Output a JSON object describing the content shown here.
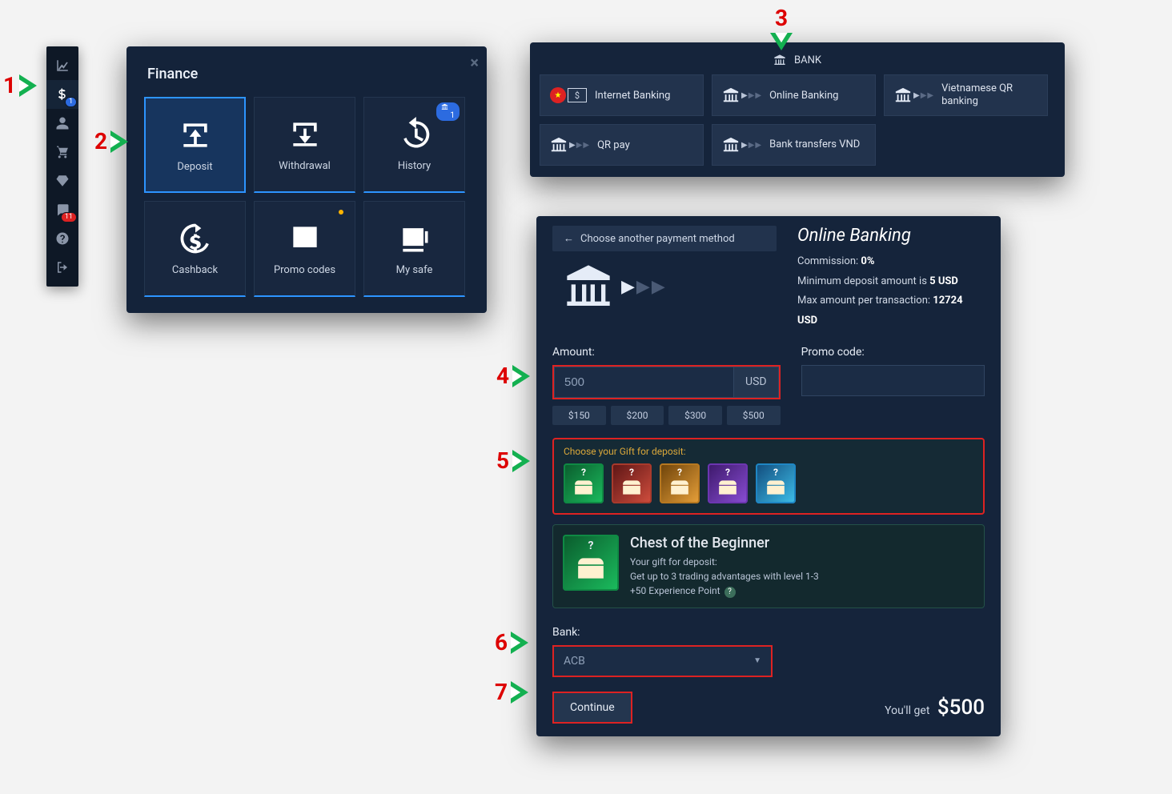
{
  "steps": [
    "1",
    "2",
    "3",
    "4",
    "5",
    "6",
    "7"
  ],
  "sidebar": {
    "items": [
      {
        "name": "chart-icon",
        "badge": null
      },
      {
        "name": "dollar-icon",
        "badge": "1",
        "active": true
      },
      {
        "name": "user-icon",
        "badge": null
      },
      {
        "name": "cart-icon",
        "badge": null
      },
      {
        "name": "diamond-icon",
        "badge": null
      },
      {
        "name": "chat-icon",
        "badge": "11",
        "badge_color": "red"
      },
      {
        "name": "help-icon",
        "badge": null
      },
      {
        "name": "logout-icon",
        "badge": null
      }
    ]
  },
  "finance": {
    "title": "Finance",
    "tiles": [
      {
        "label": "Deposit",
        "name": "deposit",
        "active": true
      },
      {
        "label": "Withdrawal",
        "name": "withdrawal"
      },
      {
        "label": "History",
        "name": "history",
        "badge": "1"
      },
      {
        "label": "Cashback",
        "name": "cashback"
      },
      {
        "label": "Promo codes",
        "name": "promo-codes",
        "dot": true
      },
      {
        "label": "My safe",
        "name": "my-safe"
      }
    ]
  },
  "bank": {
    "heading": "BANK",
    "methods": [
      {
        "label": "Internet Banking",
        "variant": "flag-monitor"
      },
      {
        "label": "Online Banking",
        "variant": "bank-arrows"
      },
      {
        "label": "Vietnamese QR banking",
        "variant": "bank-arrows"
      },
      {
        "label": "QR pay",
        "variant": "bank-arrows"
      },
      {
        "label": "Bank transfers VND",
        "variant": "bank-arrows"
      }
    ]
  },
  "deposit": {
    "back_label": "Choose another payment method",
    "title": "Online Banking",
    "commission_label": "Commission:",
    "commission_value": "0%",
    "min_label": "Minimum deposit amount is",
    "min_value": "5 USD",
    "max_label": "Max amount per transaction:",
    "max_value": "12724 USD",
    "amount_label": "Amount:",
    "amount_value": "500",
    "currency": "USD",
    "promo_label": "Promo code:",
    "promo_value": "",
    "chips": [
      "$150",
      "$200",
      "$300",
      "$500"
    ],
    "gift_label": "Choose your Gift for deposit:",
    "gift_colors": [
      "green",
      "red",
      "orange",
      "purple",
      "blue"
    ],
    "gift_detail": {
      "title": "Chest of the Beginner",
      "line1": "Your gift for deposit:",
      "line2": "Get up to 3 trading advantages with level 1-3",
      "line3": "+50 Experience Point"
    },
    "bank_label": "Bank:",
    "bank_selected": "ACB",
    "continue": "Continue",
    "you_get_label": "You'll get",
    "you_get_value": "$500"
  }
}
